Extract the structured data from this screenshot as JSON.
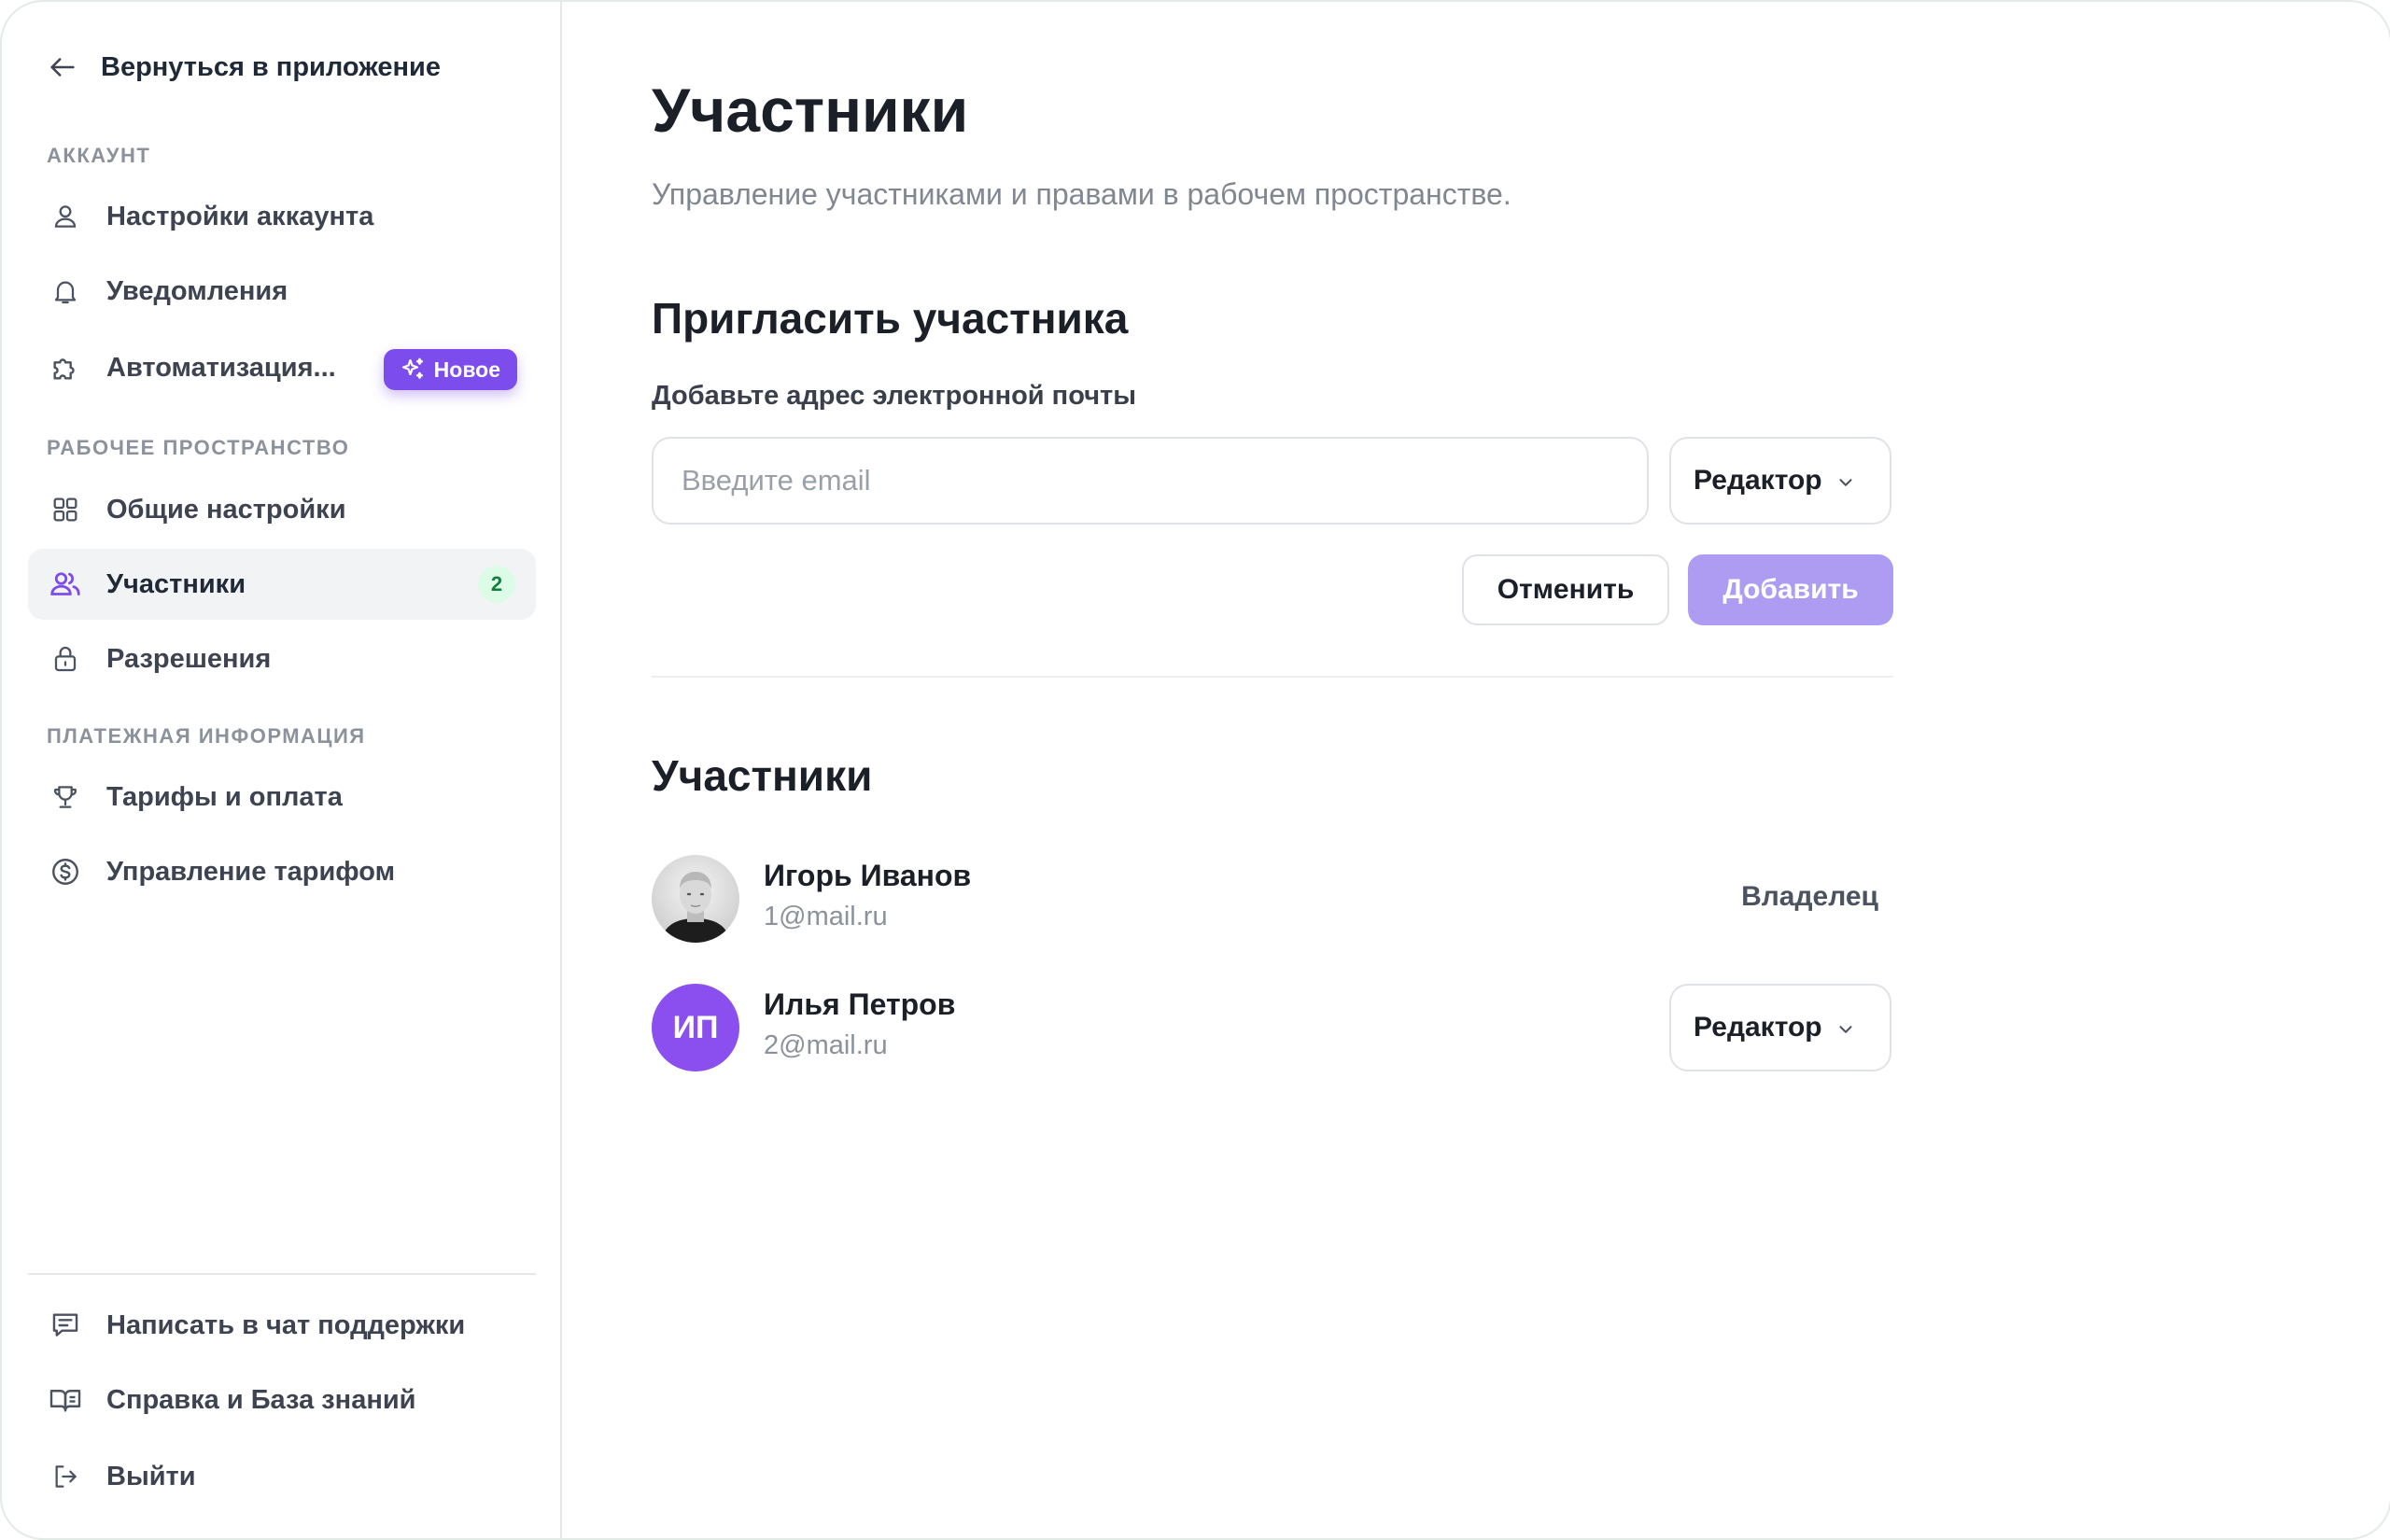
{
  "sidebar": {
    "back_label": "Вернуться в приложение",
    "sections": {
      "account": "АККАУНТ",
      "workspace": "РАБОЧЕЕ ПРОСТРАНСТВО",
      "billing": "ПЛАТЕЖНАЯ ИНФОРМАЦИЯ"
    },
    "items": {
      "account_settings": "Настройки аккаунта",
      "notifications": "Уведомления",
      "automation": "Автоматизация...",
      "automation_badge": "Новое",
      "general_settings": "Общие настройки",
      "members": "Участники",
      "members_count": "2",
      "permissions": "Разрешения",
      "plans": "Тарифы и оплата",
      "manage_plan": "Управление тарифом"
    },
    "footer": {
      "support_chat": "Написать в чат поддержки",
      "help": "Справка и База знаний",
      "logout": "Выйти"
    }
  },
  "main": {
    "title": "Участники",
    "subtitle": "Управление участниками и правами в рабочем пространстве.",
    "invite": {
      "heading": "Пригласить участника",
      "field_label": "Добавьте адрес электронной почты",
      "email_placeholder": "Введите email",
      "email_value": "",
      "role_value": "Редактор",
      "cancel_label": "Отменить",
      "add_label": "Добавить"
    },
    "members_heading": "Участники",
    "members": [
      {
        "name": "Игорь Иванов",
        "email": "1@mail.ru",
        "role": "Владелец"
      },
      {
        "name": "Илья Петров",
        "email": "2@mail.ru",
        "initials": "ИП",
        "role": "Редактор"
      }
    ]
  },
  "colors": {
    "accent": "#7c4dec",
    "accent_disabled": "#ae9cf2",
    "count_badge_bg": "#dcfce7",
    "count_badge_text": "#15803d"
  }
}
